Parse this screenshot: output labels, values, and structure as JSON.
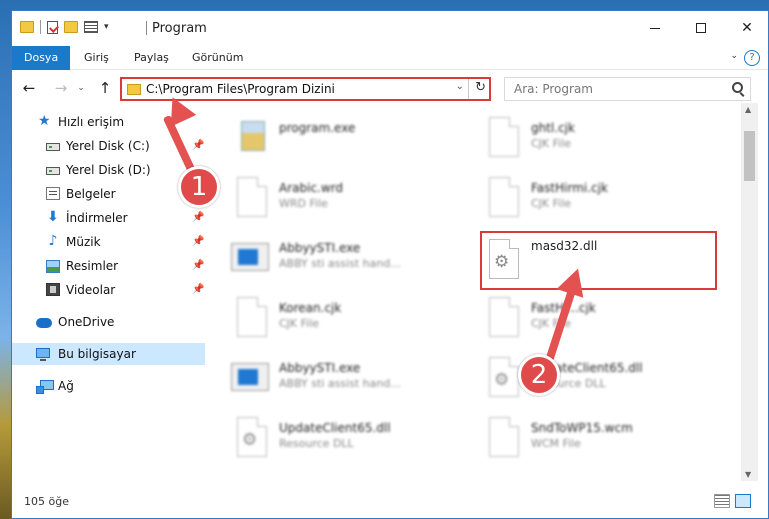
{
  "window": {
    "title": "Program"
  },
  "ribbon": {
    "tabs": [
      {
        "label": "Dosya",
        "active": true
      },
      {
        "label": "Giriş",
        "active": false
      },
      {
        "label": "Paylaş",
        "active": false
      },
      {
        "label": "Görünüm",
        "active": false
      }
    ],
    "help": "?"
  },
  "address": {
    "path": "C:\\Program Files\\Program Dizini"
  },
  "search": {
    "placeholder": "Ara: Program"
  },
  "sidebar": {
    "items": [
      {
        "label": "Hızlı erişim",
        "icon": "star-icon"
      },
      {
        "label": "Yerel Disk (C:)",
        "icon": "drive-icon"
      },
      {
        "label": "Yerel Disk (D:)",
        "icon": "drive-icon"
      },
      {
        "label": "Belgeler",
        "icon": "documents-icon"
      },
      {
        "label": "İndirmeler",
        "icon": "download-icon"
      },
      {
        "label": "Müzik",
        "icon": "music-icon"
      },
      {
        "label": "Resimler",
        "icon": "pictures-icon"
      },
      {
        "label": "Videolar",
        "icon": "video-icon"
      },
      {
        "label": "OneDrive",
        "icon": "cloud-icon"
      },
      {
        "label": "Bu bilgisayar",
        "icon": "computer-icon",
        "selected": true
      },
      {
        "label": "Ağ",
        "icon": "network-icon"
      }
    ]
  },
  "files": [
    {
      "name": "program.exe",
      "desc": ""
    },
    {
      "name": "ghtl.cjk",
      "desc": "CJK File"
    },
    {
      "name": "Arabic.wrd",
      "desc": "WRD File"
    },
    {
      "name": "FastHirmi.cjk",
      "desc": "CJK File"
    },
    {
      "name": "AbbyySTI.exe",
      "desc": "ABBY sti assist hand..."
    },
    {
      "name": "masd32.dll",
      "desc": ""
    },
    {
      "name": "Korean.cjk",
      "desc": "CJK File"
    },
    {
      "name": "FastHi...cjk",
      "desc": "CJK File"
    },
    {
      "name": "AbbyySTI.exe",
      "desc": "ABBY sti assist hand..."
    },
    {
      "name": "UpdateClient65.dll",
      "desc": "Resource DLL"
    },
    {
      "name": "UpdateClient65.dll",
      "desc": "Resource DLL"
    },
    {
      "name": "SndToWP15.wcm",
      "desc": "WCM File"
    }
  ],
  "status": {
    "count": "105 öğe"
  },
  "annotations": {
    "badge1": "1",
    "badge2": "2"
  },
  "colors": {
    "accent": "#1979ca",
    "highlight": "#d93a3a",
    "annotation": "#e04a4a"
  }
}
